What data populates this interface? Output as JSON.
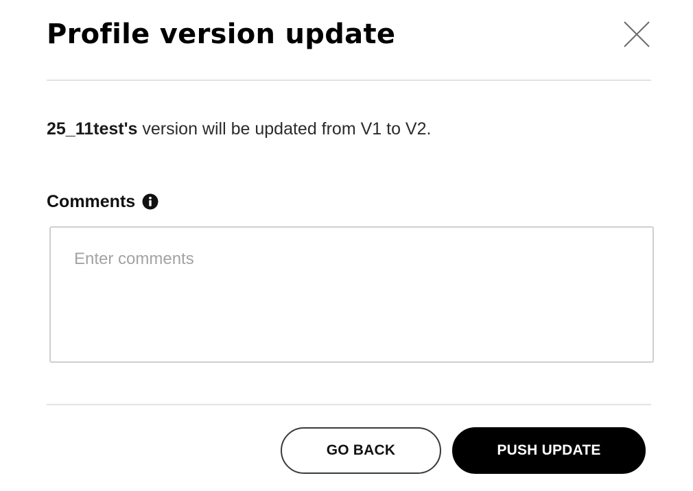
{
  "dialog": {
    "title": "Profile version update",
    "close_icon": "close-icon"
  },
  "message": {
    "profile_name": "25_11test's",
    "text": " version will be updated from V1 to V2."
  },
  "comments": {
    "label": "Comments",
    "info_icon": "info-icon",
    "value": "",
    "placeholder": "Enter comments"
  },
  "actions": {
    "back_label": "GO BACK",
    "push_label": "PUSH UPDATE"
  },
  "colors": {
    "primary_button_bg": "#000000",
    "primary_button_text": "#ffffff",
    "divider": "#e2e2e2",
    "input_border": "#cfcfcf",
    "placeholder": "#a3a3a3"
  }
}
